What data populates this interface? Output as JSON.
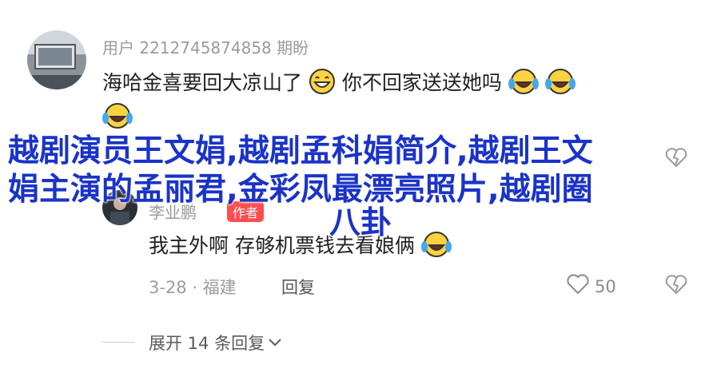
{
  "comment1": {
    "username": "用户 2212745874858 期盼",
    "text": "海哈金喜要回大凉山了",
    "text2": "你不回家送送她吗"
  },
  "comment2": {
    "username": "李业鹏",
    "author_badge": "作者",
    "text": "我主外啊 存够机票钱去看娘俩",
    "date_location": "3-28 · 福建",
    "reply_label": "回复",
    "like_count": "50"
  },
  "overlay": {
    "title_line1": "越剧演员王文娟,越剧孟科娟简介,越剧王文",
    "title_line2": "娟主演的孟丽君,金彩凤最漂亮照片,越剧圈",
    "title_line3": "八卦"
  },
  "expand": {
    "label": "展开 14 条回复"
  },
  "colors": {
    "overlay_title": "#1a33c8",
    "badge": "#ff4d4f",
    "meta": "#9c9c9c"
  },
  "icons": [
    "laugh-emoji-icon",
    "cry-laugh-emoji-icon",
    "heart-icon",
    "broken-heart-icon",
    "chevron-down-icon"
  ]
}
